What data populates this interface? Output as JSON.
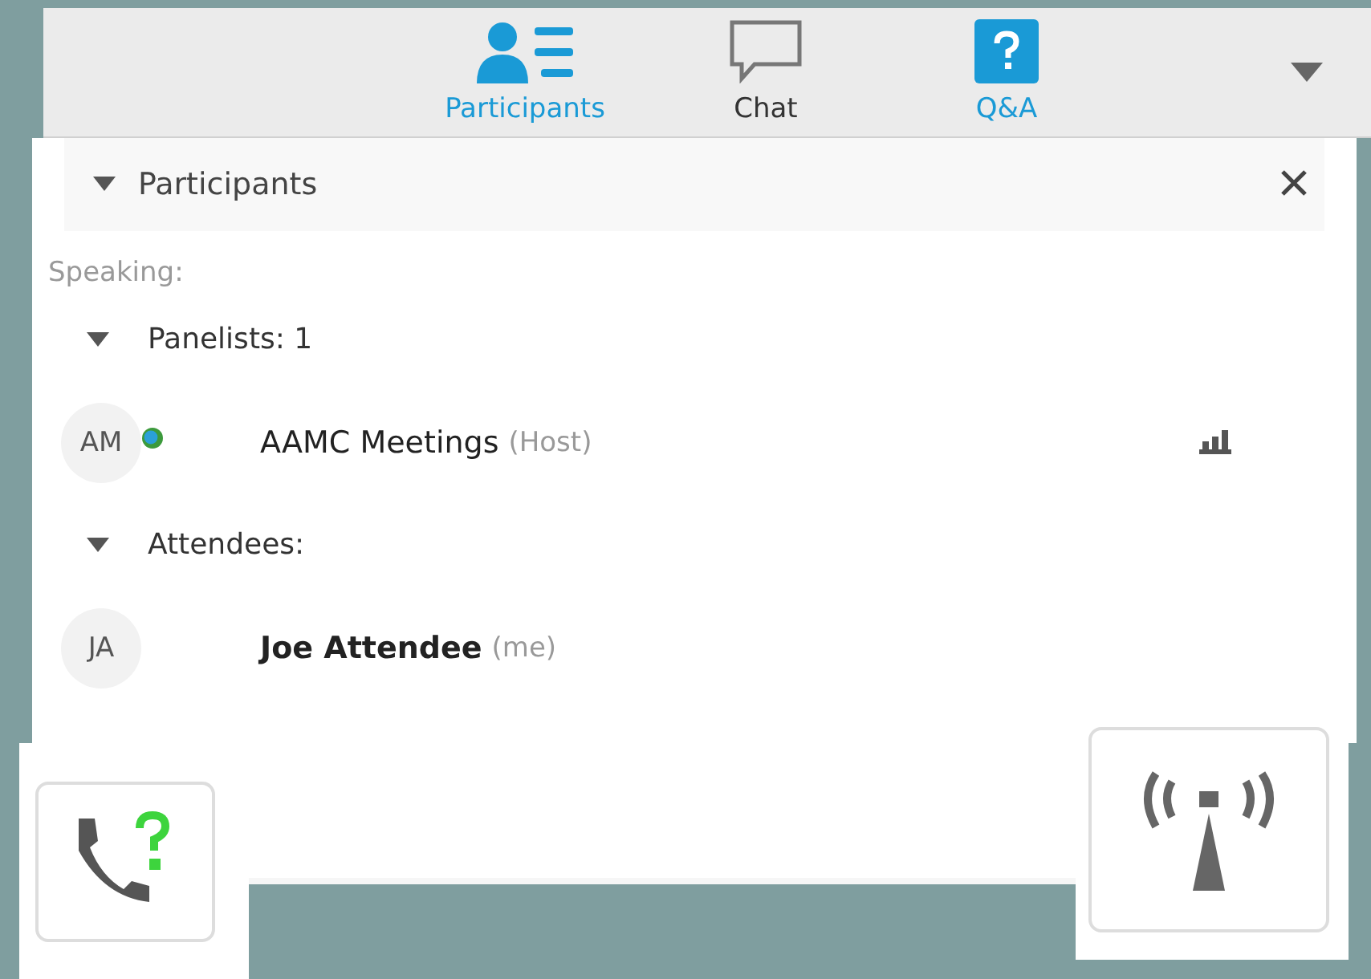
{
  "tabs": [
    {
      "label": "Participants",
      "kind": "people",
      "selected": true
    },
    {
      "label": "Chat",
      "kind": "chat",
      "selected": false
    },
    {
      "label": "Q&A",
      "kind": "qa",
      "selected": true
    }
  ],
  "panel": {
    "title": "Participants",
    "expanded": true,
    "speaking": "Speaking:",
    "groups": [
      {
        "label": "Panelists: 1",
        "expanded": true,
        "members": [
          {
            "initials": "AM",
            "name": "AAMC Meetings",
            "role": "(Host)",
            "me": false,
            "presence": true,
            "audio": true
          }
        ]
      },
      {
        "label": "Attendees:",
        "expanded": true,
        "members": [
          {
            "initials": "JA",
            "name": "Joe Attendee",
            "role": "(me)",
            "me": true,
            "presence": false,
            "audio": false
          }
        ]
      }
    ]
  }
}
